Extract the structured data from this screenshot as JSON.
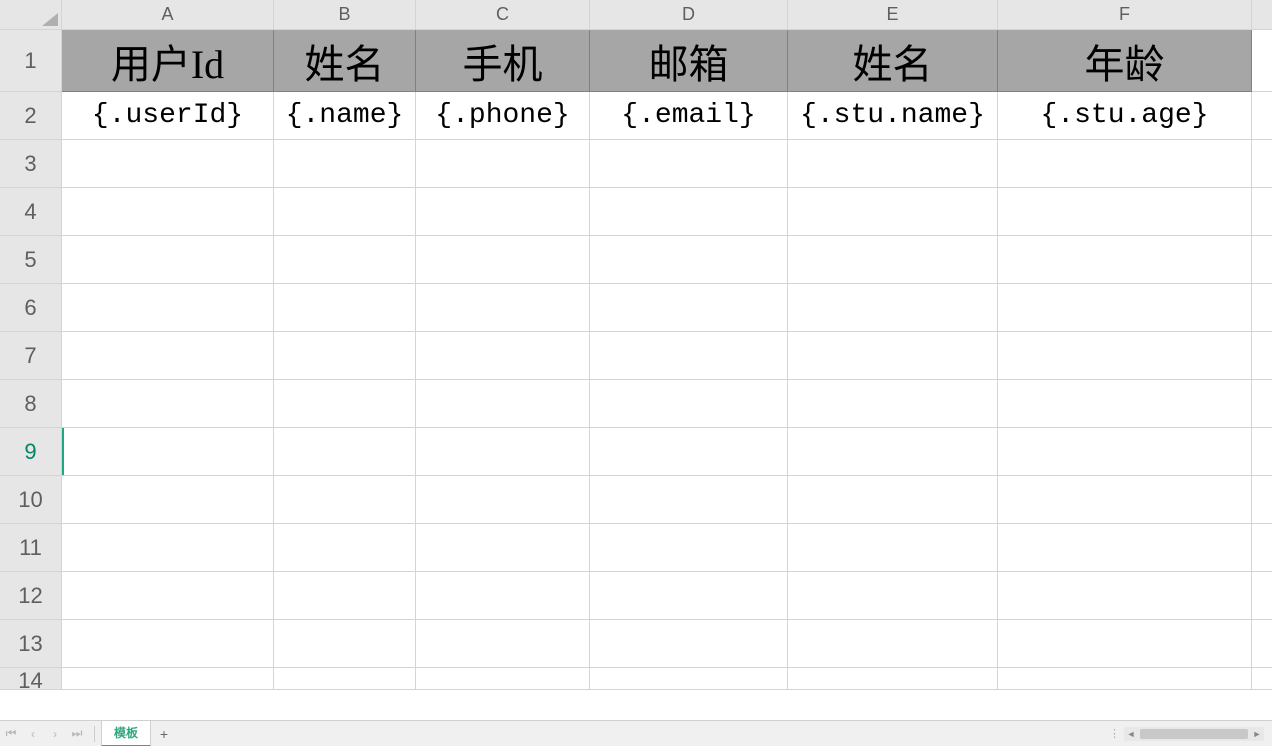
{
  "columns": [
    "A",
    "B",
    "C",
    "D",
    "E",
    "F"
  ],
  "row_numbers": [
    "1",
    "2",
    "3",
    "4",
    "5",
    "6",
    "7",
    "8",
    "9",
    "10",
    "11",
    "12",
    "13",
    "14"
  ],
  "headers": [
    "用户Id",
    "姓名",
    "手机",
    "邮箱",
    "姓名",
    "年龄"
  ],
  "template_row": [
    "{.userId}",
    "{.name}",
    "{.phone}",
    "{.email}",
    "{.stu.name}",
    "{.stu.age}"
  ],
  "sheet_tab": "模板",
  "add_sheet_label": "+"
}
